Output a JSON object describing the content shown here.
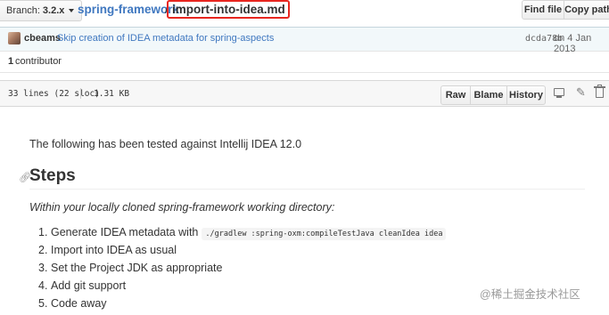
{
  "top_bar": {
    "branch_prefix": "Branch:",
    "branch_name": "3.2.x",
    "repo": "spring-framework",
    "separator": "/",
    "file_name": "import-into-idea.md",
    "find_file_label": "Find file",
    "copy_path_label": "Copy path"
  },
  "commit": {
    "author": "cbeams",
    "message": "Skip creation of IDEA metadata for spring-aspects",
    "sha": "dcda78b",
    "date": "on 4 Jan 2013"
  },
  "contributors": {
    "count": "1",
    "label": "contributor"
  },
  "file_header": {
    "lines": "33 lines (22 sloc)",
    "size": "1.31 KB",
    "raw_label": "Raw",
    "blame_label": "Blame",
    "history_label": "History"
  },
  "readme": {
    "intro": "The following has been tested against Intellij IDEA 12.0",
    "heading": "Steps",
    "subheading": "Within your locally cloned spring-framework working directory:",
    "steps": [
      {
        "num": "1.",
        "text": "Generate IDEA metadata with",
        "code": "./gradlew :spring-oxm:compileTestJava cleanIdea idea"
      },
      {
        "num": "2.",
        "text": "Import into IDEA as usual"
      },
      {
        "num": "3.",
        "text": "Set the Project JDK as appropriate"
      },
      {
        "num": "4.",
        "text": "Add git support"
      },
      {
        "num": "5.",
        "text": "Code away"
      }
    ]
  },
  "watermark": "@稀土掘金技术社区",
  "colors": {
    "link": "#4078c0",
    "highlight": "#e8261f",
    "commit_bg": "#f2f8fa"
  }
}
